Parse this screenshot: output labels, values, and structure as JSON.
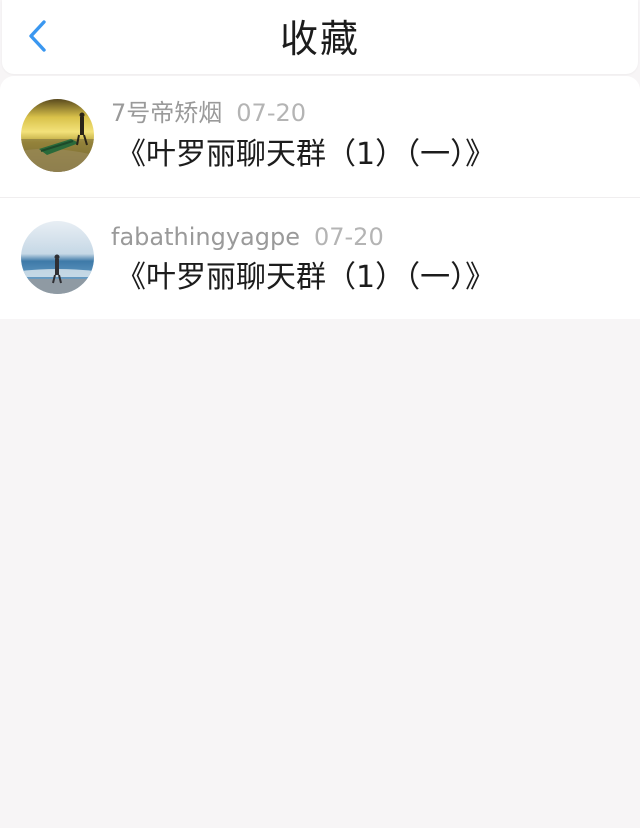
{
  "header": {
    "title": "收藏",
    "back_icon": "chevron-left-icon",
    "accent_color": "#3a97f0"
  },
  "favorites": [
    {
      "author": "7号帝矫烟",
      "date": "07-20",
      "message": "《叶罗丽聊天群（1）（一）》",
      "avatar": "landscape-photo"
    },
    {
      "author": "fabathingyagpe",
      "date": "07-20",
      "message": "《叶罗丽聊天群（1）（一）》",
      "avatar": "beach-photo"
    }
  ]
}
